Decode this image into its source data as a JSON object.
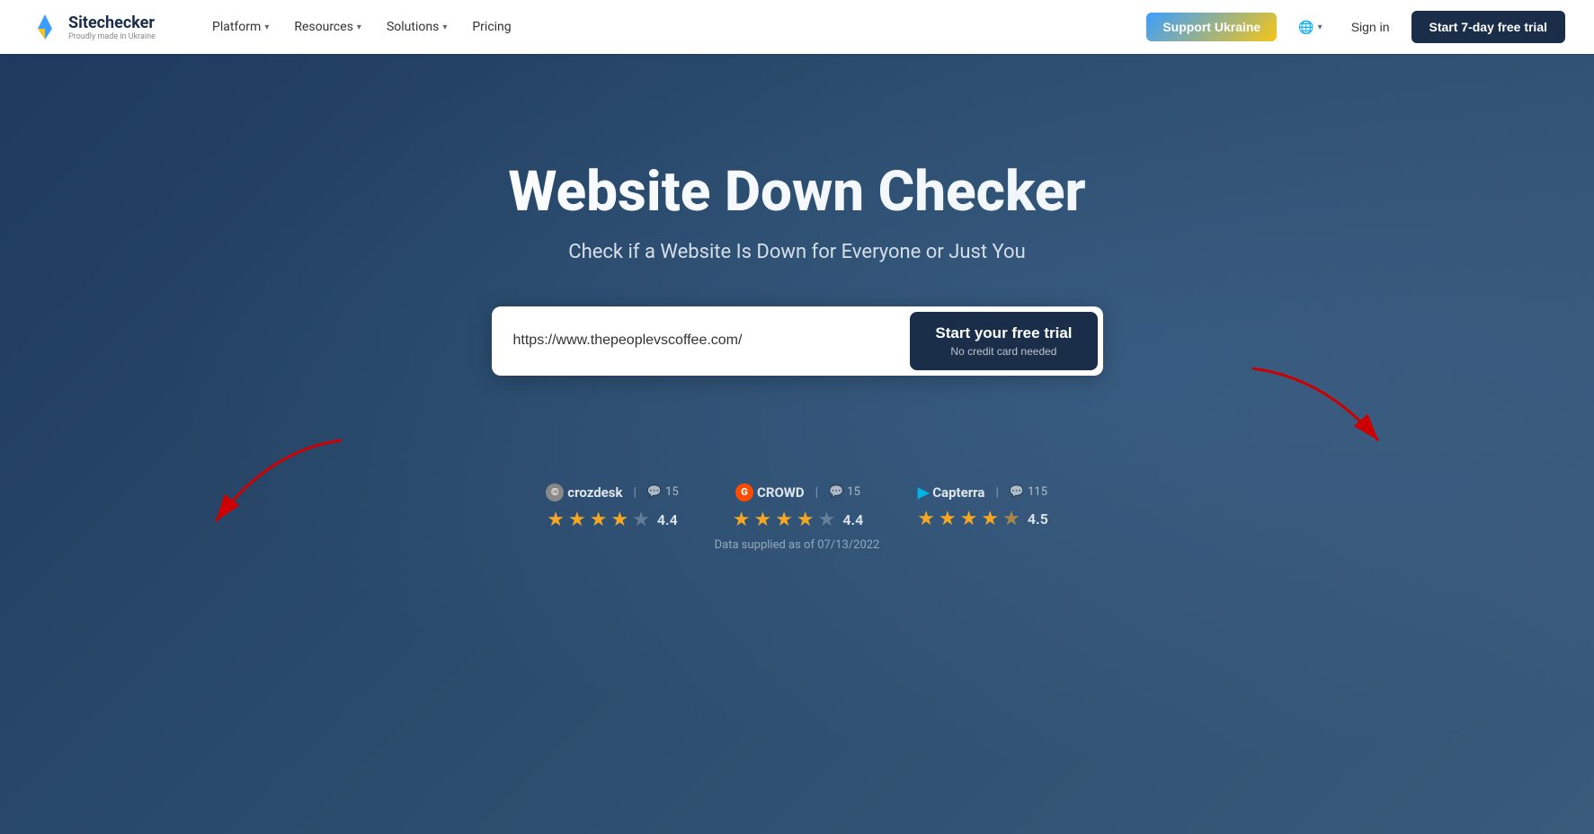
{
  "navbar": {
    "logo_name": "Sitechecker",
    "logo_tagline": "Proudly made in Ukraine",
    "nav_items": [
      {
        "label": "Platform",
        "has_dropdown": true
      },
      {
        "label": "Resources",
        "has_dropdown": true
      },
      {
        "label": "Solutions",
        "has_dropdown": true
      },
      {
        "label": "Pricing",
        "has_dropdown": false
      }
    ],
    "support_btn": "Support Ukraine",
    "globe_icon": "🌐",
    "signin_label": "Sign in",
    "trial_btn": "Start 7-day free trial"
  },
  "hero": {
    "title": "Website Down Checker",
    "subtitle": "Check if a Website Is Down for Everyone or Just You",
    "search_placeholder": "https://www.thepeoplevscoffee.com/",
    "cta_main": "Start your free trial",
    "cta_sub": "No credit card needed"
  },
  "ratings": [
    {
      "platform": "crozdesk",
      "icon": "©",
      "review_count": "15",
      "score": "4.4",
      "stars": [
        1,
        1,
        1,
        1,
        0.4
      ]
    },
    {
      "platform": "CROWD",
      "icon": "G",
      "review_count": "15",
      "score": "4.4",
      "stars": [
        1,
        1,
        1,
        1,
        0.4
      ]
    },
    {
      "platform": "Capterra",
      "icon": "▶",
      "review_count": "115",
      "score": "4.5",
      "stars": [
        1,
        1,
        1,
        1,
        0.5
      ]
    }
  ],
  "data_note": "Data supplied as of 07/13/2022"
}
